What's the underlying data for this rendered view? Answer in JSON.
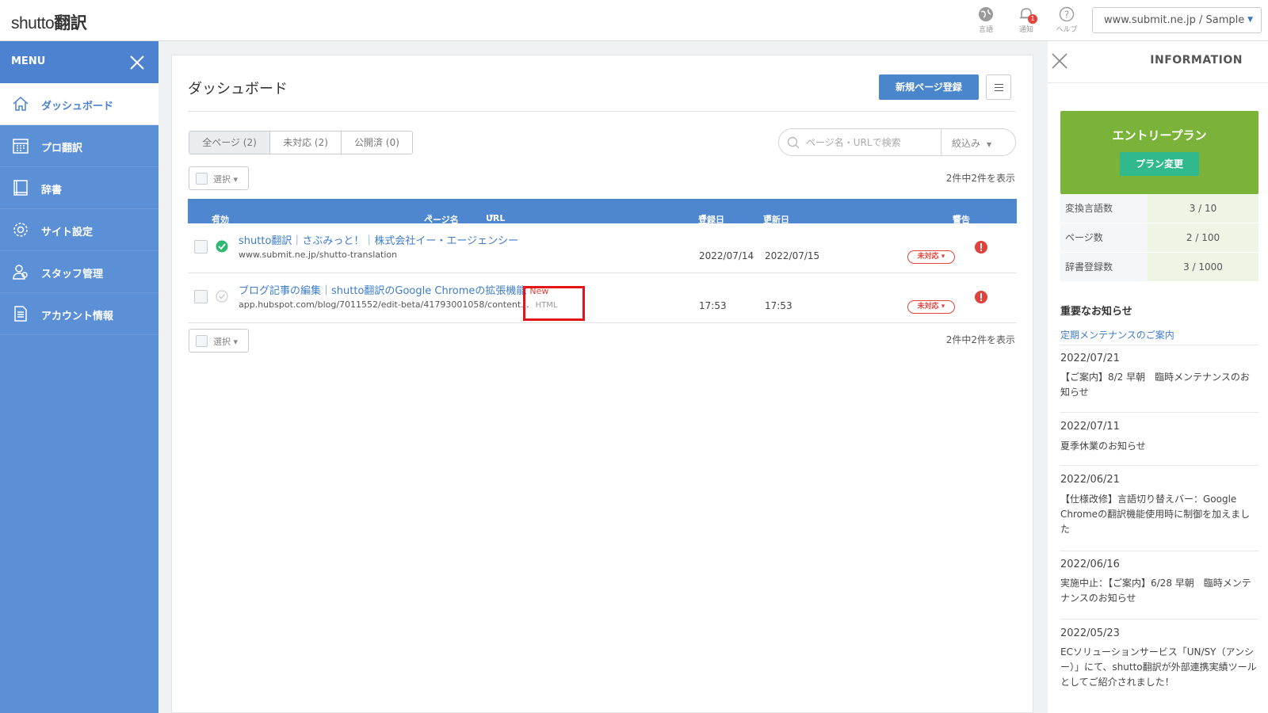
{
  "app": {
    "logo_light": "shutto",
    "logo_bold": "翻訳"
  },
  "topbar": {
    "lang_label": "言語",
    "notify_label": "通知",
    "notify_count": "1",
    "help_label": "ヘルプ",
    "site": "www.submit.ne.jp / Sample"
  },
  "sidebar": {
    "menu_title": "MENU",
    "items": [
      {
        "label": "ダッシュボード",
        "icon": "home-icon",
        "active": true
      },
      {
        "label": "プロ翻訳",
        "icon": "calendar-grid-icon",
        "active": false
      },
      {
        "label": "辞書",
        "icon": "book-icon",
        "active": false
      },
      {
        "label": "サイト設定",
        "icon": "gear-icon",
        "active": false
      },
      {
        "label": "スタッフ管理",
        "icon": "staff-icon",
        "active": false
      },
      {
        "label": "アカウント情報",
        "icon": "document-icon",
        "active": false
      }
    ]
  },
  "main": {
    "title": "ダッシュボード",
    "new_button": "新規ページ登録",
    "tabs": [
      {
        "label": "全ページ (2)",
        "selected": true
      },
      {
        "label": "未対応 (2)",
        "selected": false
      },
      {
        "label": "公開済 (0)",
        "selected": false
      }
    ],
    "search_placeholder": "ページ名・URLで検索",
    "filter_label": "絞込み",
    "select_label": "選択",
    "count_text": "2件中2件を表示",
    "columns": {
      "enabled": "有効",
      "page_name": "ページ名",
      "url": "URL",
      "registered": "登録日",
      "updated": "更新日",
      "warning": "警告"
    },
    "rows": [
      {
        "name": "shutto翻訳｜さぶみっと！｜株式会社イー・エージェンシー",
        "new_badge": "",
        "url": "www.submit.ne.jp/shutto-translation",
        "type": "",
        "registered": "2022/07/14",
        "updated": "2022/07/15",
        "status": "未対応 ▾",
        "enabled": true
      },
      {
        "name": "ブログ記事の編集｜shutto翻訳のGoogle Chromeの拡張機能",
        "new_badge": "New",
        "url": "app.hubspot.com/blog/7011552/edit-beta/41793001058/content...",
        "type": "HTML",
        "registered": "17:53",
        "updated": "17:53",
        "status": "未対応 ▾",
        "enabled": false
      }
    ]
  },
  "info": {
    "title": "INFORMATION",
    "plan_name": "エントリープラン",
    "plan_change": "プラン変更",
    "stats": [
      {
        "key": "変換言語数",
        "value": "3 / 10"
      },
      {
        "key": "ページ数",
        "value": "2 / 100"
      },
      {
        "key": "辞書登録数",
        "value": "3 / 1000"
      }
    ],
    "news_heading": "重要なお知らせ",
    "news_link": "定期メンテナンスのご案内",
    "news": [
      {
        "date": "2022/07/21",
        "body": "【ご案内】8/2 早朝　臨時メンテナンスのお知らせ"
      },
      {
        "date": "2022/07/11",
        "body": "夏季休業のお知らせ"
      },
      {
        "date": "2022/06/21",
        "body": "【仕様改修】言語切り替えバー：Google Chromeの翻訳機能使用時に制御を加えました"
      },
      {
        "date": "2022/06/16",
        "body": "実施中止：【ご案内】6/28 早朝　臨時メンテナンスのお知らせ"
      },
      {
        "date": "2022/05/23",
        "body": "ECソリューションサービス「UN/SY（アンシー）」にて、shutto翻訳が外部連携実績ツールとしてご紹介されました！"
      }
    ]
  },
  "colors": {
    "sidebar": "#5b8fd6",
    "accent": "#4a86cc",
    "plan": "#7bb33a",
    "warning": "#e0433b",
    "highlight": "#e4141b"
  }
}
